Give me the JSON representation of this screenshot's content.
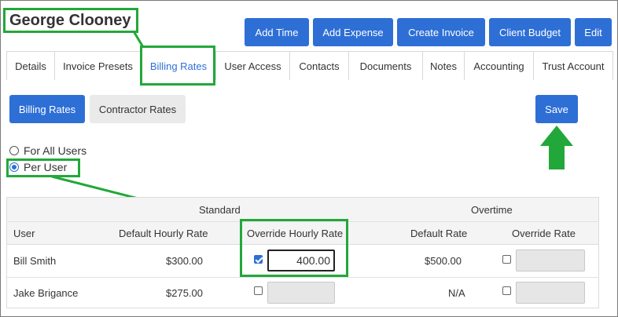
{
  "client": {
    "name": "George Clooney"
  },
  "toolbar": {
    "add_time": "Add Time",
    "add_expense": "Add Expense",
    "create_invoice": "Create Invoice",
    "client_budget": "Client Budget",
    "edit": "Edit"
  },
  "tabs": [
    {
      "label": "Details"
    },
    {
      "label": "Invoice Presets"
    },
    {
      "label": "Billing Rates"
    },
    {
      "label": "User Access"
    },
    {
      "label": "Contacts"
    },
    {
      "label": "Documents"
    },
    {
      "label": "Notes"
    },
    {
      "label": "Accounting"
    },
    {
      "label": "Trust Account"
    }
  ],
  "subtabs": {
    "billing_rates": "Billing Rates",
    "contractor_rates": "Contractor Rates"
  },
  "save_label": "Save",
  "rate_mode": {
    "options": [
      {
        "label": "For All Users",
        "checked": false
      },
      {
        "label": "Per User",
        "checked": true
      }
    ]
  },
  "rates_table": {
    "group_headers": {
      "standard": "Standard",
      "overtime": "Overtime"
    },
    "columns": {
      "user": "User",
      "default_hourly_rate": "Default Hourly Rate",
      "override_hourly_rate": "Override Hourly Rate",
      "default_rate": "Default Rate",
      "override_rate": "Override Rate"
    },
    "rows": [
      {
        "user": "Bill Smith",
        "default_hourly_rate": "$300.00",
        "override_checked": true,
        "override_value": "400.00",
        "ot_default_rate": "$500.00",
        "ot_override_checked": false
      },
      {
        "user": "Jake Brigance",
        "default_hourly_rate": "$275.00",
        "override_checked": false,
        "override_value": "",
        "ot_default_rate": "N/A",
        "ot_override_checked": false
      }
    ]
  },
  "colors": {
    "primary": "#2e6fd6",
    "annotation": "#22a83a"
  }
}
